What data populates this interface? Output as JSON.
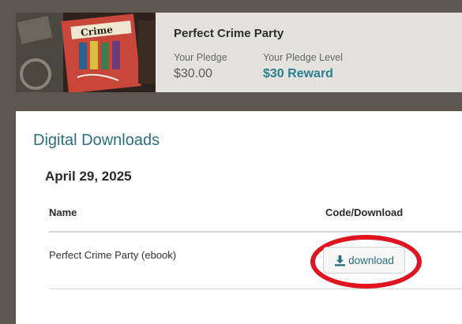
{
  "project": {
    "title": "Perfect Crime Party",
    "cover_logo_text": "Crime",
    "pledge_label": "Your Pledge",
    "pledge_value": "$30.00",
    "level_label": "Your Pledge Level",
    "level_value": "$30 Reward"
  },
  "downloads": {
    "section_title": "Digital Downloads",
    "date": "April 29, 2025",
    "columns": {
      "name": "Name",
      "code": "Code/Download"
    },
    "items": [
      {
        "name": "Perfect Crime Party (ebook)",
        "action_label": "download"
      }
    ]
  },
  "colors": {
    "accent": "#2a7f8f",
    "highlight": "#e0141f",
    "backdrop": "#5d5650"
  },
  "icons": {
    "download": "download-icon"
  }
}
